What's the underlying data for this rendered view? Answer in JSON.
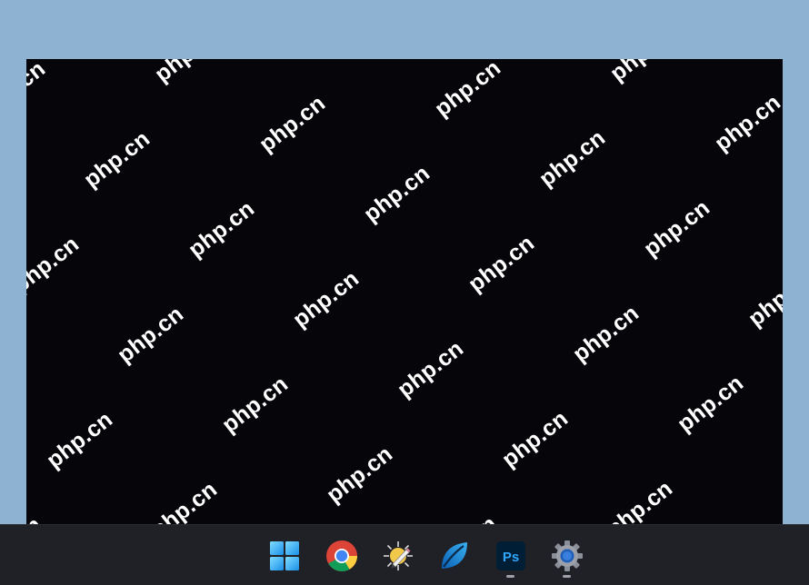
{
  "screen": {
    "watermark_text": "php.cn",
    "background": "#05050a"
  },
  "taskbar": {
    "background": "#202027",
    "apps": [
      {
        "name": "start",
        "icon": "windows-logo-icon",
        "running": false
      },
      {
        "name": "chrome",
        "icon": "chrome-icon",
        "running": false
      },
      {
        "name": "photo-viewer",
        "icon": "pencil-sun-icon",
        "running": false
      },
      {
        "name": "leaf-app",
        "icon": "leaf-icon",
        "running": false
      },
      {
        "name": "photoshop",
        "icon": "photoshop-icon",
        "label": "Ps",
        "running": true
      },
      {
        "name": "settings",
        "icon": "gear-icon",
        "running": true
      }
    ]
  }
}
